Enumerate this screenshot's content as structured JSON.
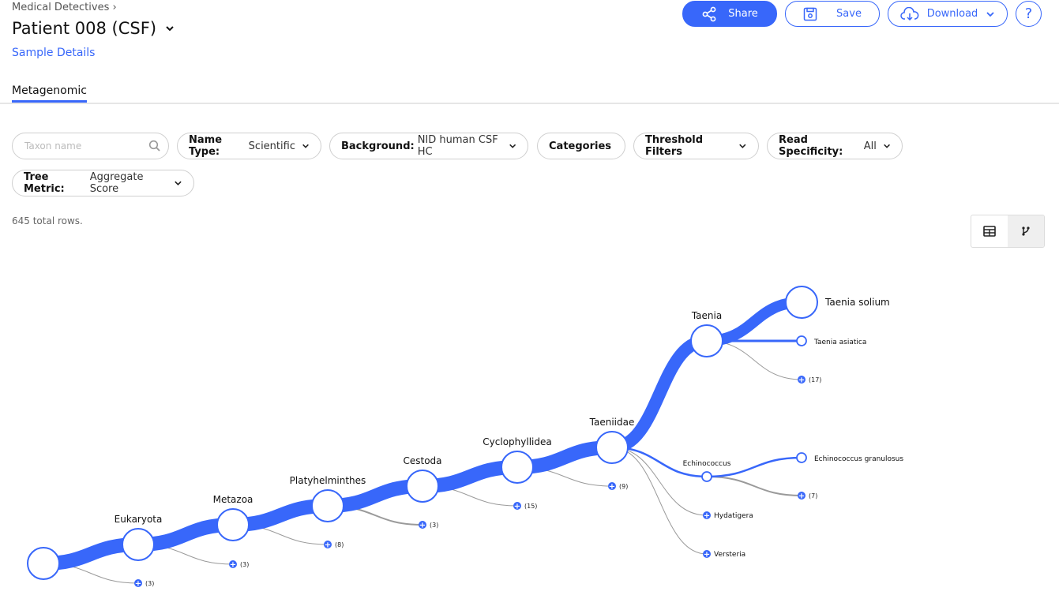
{
  "header": {
    "breadcrumb": "Medical Detectives",
    "breadcrumb_sep": "›",
    "sample_title": "Patient 008 (CSF)",
    "sample_details_link": "Sample Details"
  },
  "actions": {
    "share": "Share",
    "save": "Save",
    "download": "Download",
    "help": "?"
  },
  "tabs": [
    {
      "label": "Metagenomic",
      "active": true
    }
  ],
  "filters": {
    "search_placeholder": "Taxon name",
    "name_type": {
      "label": "Name Type:",
      "value": "Scientific"
    },
    "background": {
      "label": "Background:",
      "value": "NID human CSF HC"
    },
    "categories": {
      "label": "Categories"
    },
    "threshold": {
      "label": "Threshold Filters"
    },
    "read_specificity": {
      "label": "Read Specificity:",
      "value": "All"
    },
    "tree_metric": {
      "label": "Tree Metric:",
      "value": "Aggregate Score"
    }
  },
  "total_rows": "645 total rows.",
  "view_toggle": {
    "options": [
      "table-icon",
      "tree-icon"
    ],
    "active": "tree-icon"
  },
  "colors": {
    "accent": "#3867fa",
    "link_gray": "#9a9a9a"
  },
  "tree": {
    "nodes": [
      {
        "id": "root",
        "label": ""
      },
      {
        "id": "eukaryota",
        "label": "Eukaryota"
      },
      {
        "id": "metazoa",
        "label": "Metazoa"
      },
      {
        "id": "platyhelminthes",
        "label": "Platyhelminthes"
      },
      {
        "id": "cestoda",
        "label": "Cestoda"
      },
      {
        "id": "cyclophyllidea",
        "label": "Cyclophyllidea"
      },
      {
        "id": "taeniidae",
        "label": "Taeniidae"
      },
      {
        "id": "taenia",
        "label": "Taenia"
      },
      {
        "id": "taenia_solium",
        "label": "Taenia solium"
      },
      {
        "id": "taenia_asiatica",
        "label": "Taenia asiatica"
      },
      {
        "id": "echinococcus",
        "label": "Echinococcus"
      },
      {
        "id": "echinococcus_granulosus",
        "label": "Echinococcus granulosus"
      },
      {
        "id": "hydatigera",
        "label": "Hydatigera"
      },
      {
        "id": "versteria",
        "label": "Versteria"
      }
    ],
    "collapsed": [
      {
        "parent": "root",
        "label": "(3)"
      },
      {
        "parent": "eukaryota",
        "label": "(3)"
      },
      {
        "parent": "metazoa",
        "label": "(8)"
      },
      {
        "parent": "platyhelminthes",
        "label": "(3)"
      },
      {
        "parent": "cestoda",
        "label": "(15)"
      },
      {
        "parent": "cyclophyllidea",
        "label": "(9)"
      },
      {
        "parent": "taenia",
        "label": "(17)"
      },
      {
        "parent": "echinococcus",
        "label": "(7)"
      }
    ]
  }
}
